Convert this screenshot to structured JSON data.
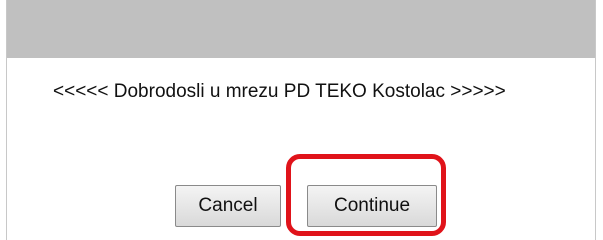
{
  "dialog": {
    "message": "<<<<< Dobrodosli u mrezu PD TEKO Kostolac >>>>>",
    "cancel_label": "Cancel",
    "continue_label": "Continue"
  },
  "colors": {
    "titlebar": "#c0c0c0",
    "highlight": "#e0131a"
  }
}
